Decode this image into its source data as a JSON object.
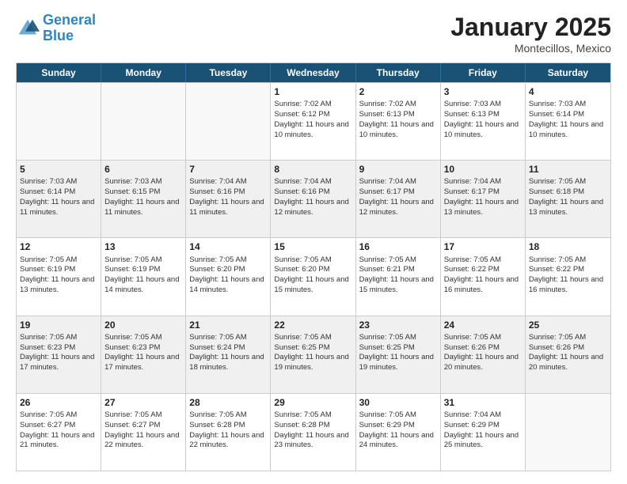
{
  "logo": {
    "line1": "General",
    "line2": "Blue"
  },
  "title": "January 2025",
  "subtitle": "Montecillos, Mexico",
  "days": [
    "Sunday",
    "Monday",
    "Tuesday",
    "Wednesday",
    "Thursday",
    "Friday",
    "Saturday"
  ],
  "rows": [
    [
      {
        "num": "",
        "text": ""
      },
      {
        "num": "",
        "text": ""
      },
      {
        "num": "",
        "text": ""
      },
      {
        "num": "1",
        "text": "Sunrise: 7:02 AM\nSunset: 6:12 PM\nDaylight: 11 hours and 10 minutes."
      },
      {
        "num": "2",
        "text": "Sunrise: 7:02 AM\nSunset: 6:13 PM\nDaylight: 11 hours and 10 minutes."
      },
      {
        "num": "3",
        "text": "Sunrise: 7:03 AM\nSunset: 6:13 PM\nDaylight: 11 hours and 10 minutes."
      },
      {
        "num": "4",
        "text": "Sunrise: 7:03 AM\nSunset: 6:14 PM\nDaylight: 11 hours and 10 minutes."
      }
    ],
    [
      {
        "num": "5",
        "text": "Sunrise: 7:03 AM\nSunset: 6:14 PM\nDaylight: 11 hours and 11 minutes."
      },
      {
        "num": "6",
        "text": "Sunrise: 7:03 AM\nSunset: 6:15 PM\nDaylight: 11 hours and 11 minutes."
      },
      {
        "num": "7",
        "text": "Sunrise: 7:04 AM\nSunset: 6:16 PM\nDaylight: 11 hours and 11 minutes."
      },
      {
        "num": "8",
        "text": "Sunrise: 7:04 AM\nSunset: 6:16 PM\nDaylight: 11 hours and 12 minutes."
      },
      {
        "num": "9",
        "text": "Sunrise: 7:04 AM\nSunset: 6:17 PM\nDaylight: 11 hours and 12 minutes."
      },
      {
        "num": "10",
        "text": "Sunrise: 7:04 AM\nSunset: 6:17 PM\nDaylight: 11 hours and 13 minutes."
      },
      {
        "num": "11",
        "text": "Sunrise: 7:05 AM\nSunset: 6:18 PM\nDaylight: 11 hours and 13 minutes."
      }
    ],
    [
      {
        "num": "12",
        "text": "Sunrise: 7:05 AM\nSunset: 6:19 PM\nDaylight: 11 hours and 13 minutes."
      },
      {
        "num": "13",
        "text": "Sunrise: 7:05 AM\nSunset: 6:19 PM\nDaylight: 11 hours and 14 minutes."
      },
      {
        "num": "14",
        "text": "Sunrise: 7:05 AM\nSunset: 6:20 PM\nDaylight: 11 hours and 14 minutes."
      },
      {
        "num": "15",
        "text": "Sunrise: 7:05 AM\nSunset: 6:20 PM\nDaylight: 11 hours and 15 minutes."
      },
      {
        "num": "16",
        "text": "Sunrise: 7:05 AM\nSunset: 6:21 PM\nDaylight: 11 hours and 15 minutes."
      },
      {
        "num": "17",
        "text": "Sunrise: 7:05 AM\nSunset: 6:22 PM\nDaylight: 11 hours and 16 minutes."
      },
      {
        "num": "18",
        "text": "Sunrise: 7:05 AM\nSunset: 6:22 PM\nDaylight: 11 hours and 16 minutes."
      }
    ],
    [
      {
        "num": "19",
        "text": "Sunrise: 7:05 AM\nSunset: 6:23 PM\nDaylight: 11 hours and 17 minutes."
      },
      {
        "num": "20",
        "text": "Sunrise: 7:05 AM\nSunset: 6:23 PM\nDaylight: 11 hours and 17 minutes."
      },
      {
        "num": "21",
        "text": "Sunrise: 7:05 AM\nSunset: 6:24 PM\nDaylight: 11 hours and 18 minutes."
      },
      {
        "num": "22",
        "text": "Sunrise: 7:05 AM\nSunset: 6:25 PM\nDaylight: 11 hours and 19 minutes."
      },
      {
        "num": "23",
        "text": "Sunrise: 7:05 AM\nSunset: 6:25 PM\nDaylight: 11 hours and 19 minutes."
      },
      {
        "num": "24",
        "text": "Sunrise: 7:05 AM\nSunset: 6:26 PM\nDaylight: 11 hours and 20 minutes."
      },
      {
        "num": "25",
        "text": "Sunrise: 7:05 AM\nSunset: 6:26 PM\nDaylight: 11 hours and 20 minutes."
      }
    ],
    [
      {
        "num": "26",
        "text": "Sunrise: 7:05 AM\nSunset: 6:27 PM\nDaylight: 11 hours and 21 minutes."
      },
      {
        "num": "27",
        "text": "Sunrise: 7:05 AM\nSunset: 6:27 PM\nDaylight: 11 hours and 22 minutes."
      },
      {
        "num": "28",
        "text": "Sunrise: 7:05 AM\nSunset: 6:28 PM\nDaylight: 11 hours and 22 minutes."
      },
      {
        "num": "29",
        "text": "Sunrise: 7:05 AM\nSunset: 6:28 PM\nDaylight: 11 hours and 23 minutes."
      },
      {
        "num": "30",
        "text": "Sunrise: 7:05 AM\nSunset: 6:29 PM\nDaylight: 11 hours and 24 minutes."
      },
      {
        "num": "31",
        "text": "Sunrise: 7:04 AM\nSunset: 6:29 PM\nDaylight: 11 hours and 25 minutes."
      },
      {
        "num": "",
        "text": ""
      }
    ]
  ]
}
